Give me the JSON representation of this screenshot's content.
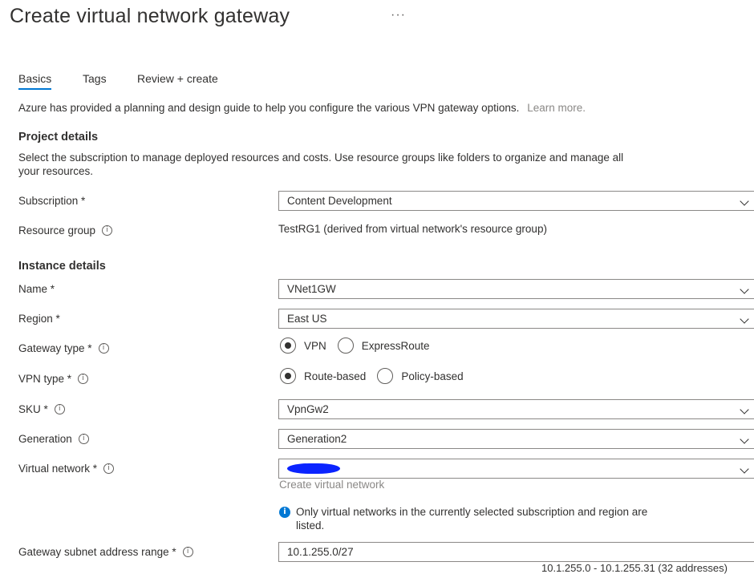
{
  "page": {
    "title": "Create virtual network gateway",
    "more_label": "···"
  },
  "tabs": [
    {
      "label": "Basics",
      "active": true
    },
    {
      "label": "Tags",
      "active": false
    },
    {
      "label": "Review + create",
      "active": false
    }
  ],
  "intro": {
    "text": "Azure has provided a planning and design guide to help you configure the various VPN gateway options.",
    "link": "Learn more."
  },
  "project": {
    "heading": "Project details",
    "description_line1": "Select the subscription to manage deployed resources and costs. Use resource groups like folders to organize and manage all",
    "description_line2": "your resources.",
    "subscription_label": "Subscription *",
    "subscription_value": "Content Development",
    "resource_group_label": "Resource group",
    "resource_group_value": "TestRG1 (derived from virtual network's resource group)"
  },
  "instance": {
    "heading": "Instance details",
    "name_label": "Name *",
    "name_value": "VNet1GW",
    "region_label": "Region *",
    "region_value": "East US",
    "gateway_type_label": "Gateway type *",
    "gateway_type_options": [
      "VPN",
      "ExpressRoute"
    ],
    "gateway_type_selected": "VPN",
    "vpn_type_label": "VPN type *",
    "vpn_type_options": [
      "Route-based",
      "Policy-based"
    ],
    "vpn_type_selected": "Route-based",
    "sku_label": "SKU *",
    "sku_value": "VpnGw2",
    "generation_label": "Generation",
    "generation_value": "Generation2",
    "vnet_label": "Virtual network *",
    "vnet_value": "",
    "create_vnet_link": "Create virtual network",
    "vnet_note_line1": "Only virtual networks in the currently selected subscription and region are",
    "vnet_note_line2": "listed.",
    "subnet_label": "Gateway subnet address range *",
    "subnet_value": "10.1.255.0/27",
    "subnet_hint": "10.1.255.0 - 10.1.255.31 (32 addresses)"
  },
  "colors": {
    "accent": "#0078d4",
    "redaction": "#0b24ff"
  }
}
